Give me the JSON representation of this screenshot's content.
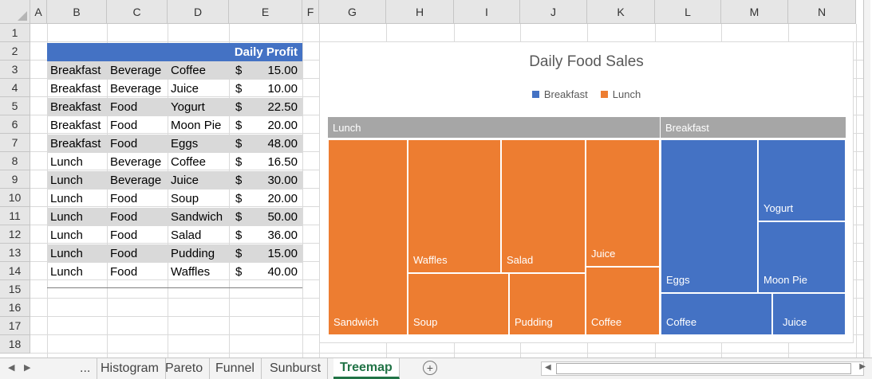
{
  "columns": [
    "A",
    "B",
    "C",
    "D",
    "E",
    "F",
    "G",
    "H",
    "I",
    "J",
    "K",
    "L",
    "M",
    "N"
  ],
  "rows": [
    "1",
    "2",
    "3",
    "4",
    "5",
    "6",
    "7",
    "8",
    "9",
    "10",
    "11",
    "12",
    "13",
    "14",
    "15",
    "16",
    "17",
    "18"
  ],
  "table": {
    "header": "Daily Profit",
    "rows": [
      {
        "meal": "Breakfast",
        "type": "Beverage",
        "item": "Coffee",
        "cur": "$",
        "amount": "15.00"
      },
      {
        "meal": "Breakfast",
        "type": "Beverage",
        "item": "Juice",
        "cur": "$",
        "amount": "10.00"
      },
      {
        "meal": "Breakfast",
        "type": "Food",
        "item": "Yogurt",
        "cur": "$",
        "amount": "22.50"
      },
      {
        "meal": "Breakfast",
        "type": "Food",
        "item": "Moon Pie",
        "cur": "$",
        "amount": "20.00"
      },
      {
        "meal": "Breakfast",
        "type": "Food",
        "item": "Eggs",
        "cur": "$",
        "amount": "48.00"
      },
      {
        "meal": "Lunch",
        "type": "Beverage",
        "item": "Coffee",
        "cur": "$",
        "amount": "16.50"
      },
      {
        "meal": "Lunch",
        "type": "Beverage",
        "item": "Juice",
        "cur": "$",
        "amount": "30.00"
      },
      {
        "meal": "Lunch",
        "type": "Food",
        "item": "Soup",
        "cur": "$",
        "amount": "20.00"
      },
      {
        "meal": "Lunch",
        "type": "Food",
        "item": "Sandwich",
        "cur": "$",
        "amount": "50.00"
      },
      {
        "meal": "Lunch",
        "type": "Food",
        "item": "Salad",
        "cur": "$",
        "amount": "36.00"
      },
      {
        "meal": "Lunch",
        "type": "Food",
        "item": "Pudding",
        "cur": "$",
        "amount": "15.00"
      },
      {
        "meal": "Lunch",
        "type": "Food",
        "item": "Waffles",
        "cur": "$",
        "amount": "40.00"
      }
    ]
  },
  "chart": {
    "title": "Daily Food Sales",
    "legend": [
      {
        "label": "Breakfast",
        "color": "#4472c4"
      },
      {
        "label": "Lunch",
        "color": "#ed7d31"
      }
    ],
    "groups": {
      "lunch": "Lunch",
      "breakfast": "Breakfast"
    },
    "tiles": {
      "sandwich": "Sandwich",
      "waffles": "Waffles",
      "soup": "Soup",
      "salad": "Salad",
      "pudding": "Pudding",
      "juice_l": "Juice",
      "coffee_l": "Coffee",
      "eggs": "Eggs",
      "yogurt": "Yogurt",
      "moonpie": "Moon Pie",
      "coffee_b": "Coffee",
      "juice_b": "Juice"
    }
  },
  "chart_data": {
    "type": "treemap",
    "title": "Daily Food Sales",
    "series": [
      {
        "name": "Breakfast",
        "values": [
          {
            "label": "Coffee",
            "value": 15.0
          },
          {
            "label": "Juice",
            "value": 10.0
          },
          {
            "label": "Yogurt",
            "value": 22.5
          },
          {
            "label": "Moon Pie",
            "value": 20.0
          },
          {
            "label": "Eggs",
            "value": 48.0
          }
        ]
      },
      {
        "name": "Lunch",
        "values": [
          {
            "label": "Coffee",
            "value": 16.5
          },
          {
            "label": "Juice",
            "value": 30.0
          },
          {
            "label": "Soup",
            "value": 20.0
          },
          {
            "label": "Sandwich",
            "value": 50.0
          },
          {
            "label": "Salad",
            "value": 36.0
          },
          {
            "label": "Pudding",
            "value": 15.0
          },
          {
            "label": "Waffles",
            "value": 40.0
          }
        ]
      }
    ],
    "legend_position": "top"
  },
  "tabs": {
    "ellipsis": "...",
    "items": [
      "Histogram",
      "Pareto",
      "Funnel",
      "Sunburst",
      "Treemap"
    ],
    "add": "+"
  }
}
